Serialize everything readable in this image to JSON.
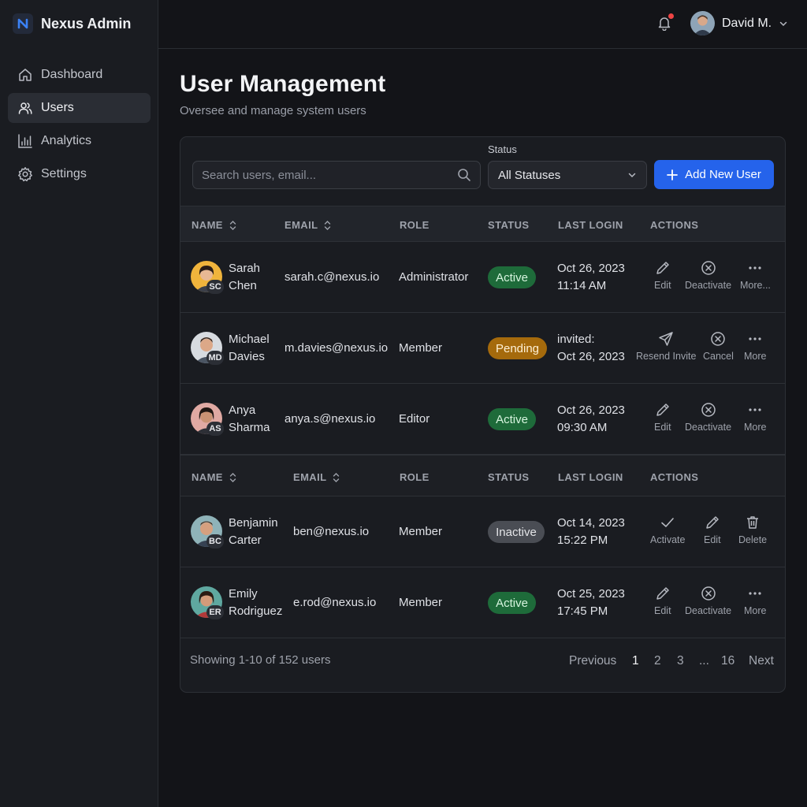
{
  "app": {
    "name": "Nexus Admin",
    "brand_color": "#2563eb"
  },
  "sidebar": {
    "items": [
      {
        "label": "Dashboard",
        "icon": "home-icon",
        "active": false
      },
      {
        "label": "Users",
        "icon": "users-icon",
        "active": true
      },
      {
        "label": "Analytics",
        "icon": "bar-chart-icon",
        "active": false
      },
      {
        "label": "Settings",
        "icon": "gear-icon",
        "active": false
      }
    ]
  },
  "topbar": {
    "user_name": "David M.",
    "has_notification": true
  },
  "page": {
    "title": "User Management",
    "subtitle": "Oversee and manage system users"
  },
  "toolbar": {
    "search_placeholder": "Search users, email...",
    "status_label": "Status",
    "status_value": "All Statuses",
    "add_button": "Add New User"
  },
  "table": {
    "headers": {
      "name": "NAME",
      "email": "EMAIL",
      "role": "ROLE",
      "status": "STATUS",
      "last_login": "LAST LOGIN",
      "actions": "ACTIONS"
    },
    "rows": [
      {
        "first": "Sarah",
        "last": "Chen",
        "initials": "SC",
        "email": "sarah.c@nexus.io",
        "role": "Administrator",
        "status": "Active",
        "login_line1": "Oct 26, 2023",
        "login_line2": "11:14 AM",
        "actions": [
          {
            "label": "Edit",
            "icon": "pencil-icon"
          },
          {
            "label": "Deactivate",
            "icon": "x-circle-icon"
          },
          {
            "label": "More...",
            "icon": "more-icon"
          }
        ]
      },
      {
        "first": "Michael",
        "last": "Davies",
        "initials": "MD",
        "email": "m.davies@nexus.io",
        "role": "Member",
        "status": "Pending",
        "login_line1": "invited:",
        "login_line2": "Oct 26, 2023",
        "actions": [
          {
            "label": "Resend Invite",
            "icon": "send-icon"
          },
          {
            "label": "Cancel",
            "icon": "x-circle-icon"
          },
          {
            "label": "More",
            "icon": "more-icon"
          }
        ]
      },
      {
        "first": "Anya",
        "last": "Sharma",
        "initials": "AS",
        "email": "anya.s@nexus.io",
        "role": "Editor",
        "status": "Active",
        "login_line1": "Oct 26, 2023",
        "login_line2": "09:30 AM",
        "actions": [
          {
            "label": "Edit",
            "icon": "pencil-icon"
          },
          {
            "label": "Deactivate",
            "icon": "x-circle-icon"
          },
          {
            "label": "More",
            "icon": "more-icon"
          }
        ]
      },
      {
        "first": "Benjamin",
        "last": "Carter",
        "initials": "BC",
        "email": "ben@nexus.io",
        "role": "Member",
        "status": "Inactive",
        "login_line1": "Oct 14, 2023",
        "login_line2": "15:22 PM",
        "actions": [
          {
            "label": "Activate",
            "icon": "check-icon"
          },
          {
            "label": "Edit",
            "icon": "pencil-icon"
          },
          {
            "label": "Delete",
            "icon": "trash-icon"
          }
        ]
      },
      {
        "first": "Emily",
        "last": "Rodriguez",
        "initials": "ER",
        "email": "e.rod@nexus.io",
        "role": "Member",
        "status": "Active",
        "login_line1": "Oct 25, 2023",
        "login_line2": "17:45 PM",
        "actions": [
          {
            "label": "Edit",
            "icon": "pencil-icon"
          },
          {
            "label": "Deactivate",
            "icon": "x-circle-icon"
          },
          {
            "label": "More",
            "icon": "more-icon"
          }
        ]
      }
    ]
  },
  "footer": {
    "summary": "Showing 1-10 of 152 users",
    "previous": "Previous",
    "pages": [
      "1",
      "2",
      "3",
      "...",
      "16"
    ],
    "next": "Next"
  },
  "colors": {
    "active": "#1e6b3a",
    "pending": "#a56a0c",
    "inactive": "#4a4d54",
    "background": "#131418"
  }
}
